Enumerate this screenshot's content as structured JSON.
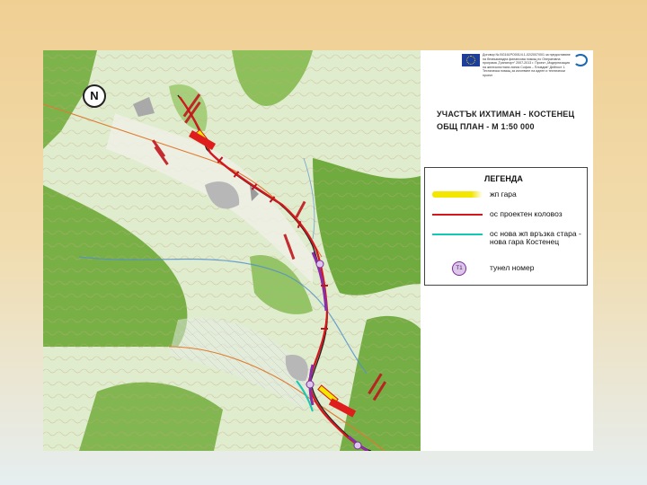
{
  "map": {
    "north_label": "N"
  },
  "header": {
    "eu_text": "Договор № BG161PO001/4.1-02/2007/001 за предоставяне на безвъзмездна финансова помощ по Оперативна програма „Транспорт“ 2007-2013 г. Проект „Модернизация на железопътната линия София – Пловдив“ Дейност 1. Техническа помощ за изготвяне на идеен и технически проект"
  },
  "titles": {
    "section": "УЧАСТЪК ИХТИМАН - КОСТЕНЕЦ",
    "plan": "ОБЩ ПЛАН - М 1:50 000"
  },
  "legend": {
    "title": "ЛЕГЕНДА",
    "items": [
      {
        "label": "жп гара",
        "color": "#f3e600"
      },
      {
        "label": "ос проектен коловоз",
        "color": "#d4171d"
      },
      {
        "label": "ос нова жп връзка стара - нова гара Костенец",
        "color": "#13c9b4"
      },
      {
        "label": "тунел номер",
        "symbol": "T1",
        "color": "#7d2a9f"
      }
    ]
  }
}
